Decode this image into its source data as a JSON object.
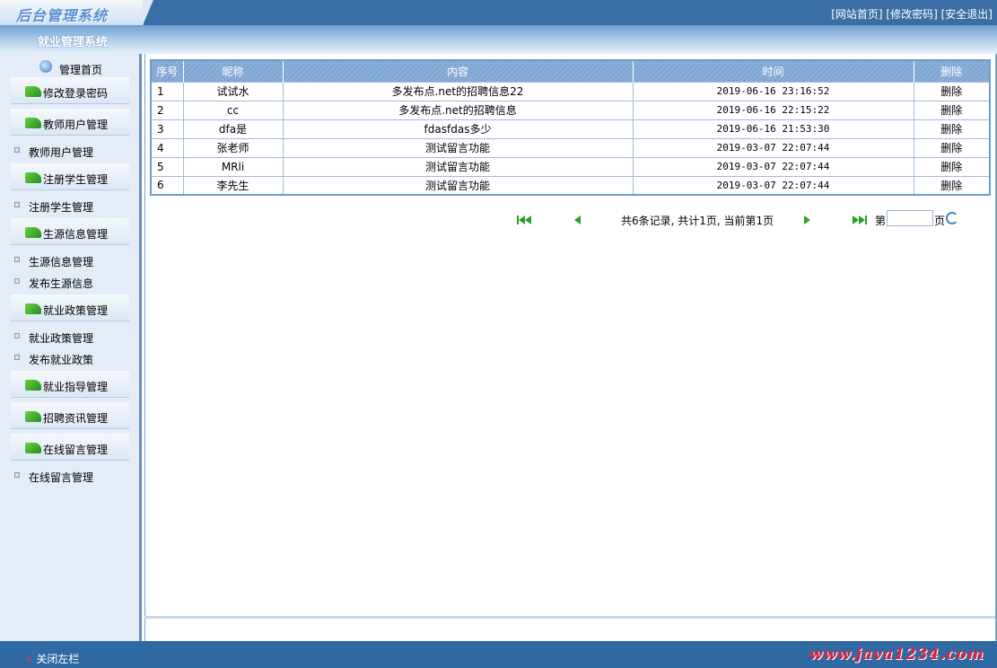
{
  "header": {
    "logo": "后台管理系统",
    "links": [
      "[网站首页]",
      "[修改密码]",
      "[安全退出]"
    ],
    "subtitle": "就业管理系统"
  },
  "sidebar": {
    "home": "管理首页",
    "sections": [
      {
        "label": "修改登录密码",
        "items": []
      },
      {
        "label": "教师用户管理",
        "items": [
          "教师用户管理"
        ]
      },
      {
        "label": "注册学生管理",
        "items": [
          "注册学生管理"
        ]
      },
      {
        "label": "生源信息管理",
        "items": [
          "生源信息管理",
          "发布生源信息"
        ]
      },
      {
        "label": "就业政策管理",
        "items": [
          "就业政策管理",
          "发布就业政策"
        ]
      },
      {
        "label": "就业指导管理",
        "items": []
      },
      {
        "label": "招聘资讯管理",
        "items": []
      },
      {
        "label": "在线留言管理",
        "items": [
          "在线留言管理"
        ]
      }
    ]
  },
  "table": {
    "headers": [
      "序号",
      "昵称",
      "内容",
      "时间",
      "删除"
    ],
    "rows": [
      [
        "1",
        "试试水",
        "多发布点.net的招聘信息22",
        "2019-06-16 23:16:52",
        "删除"
      ],
      [
        "2",
        "cc",
        "多发布点.net的招聘信息",
        "2019-06-16 22:15:22",
        "删除"
      ],
      [
        "3",
        "dfa是",
        "fdasfdas多少",
        "2019-06-16 21:53:30",
        "删除"
      ],
      [
        "4",
        "张老师",
        "测试留言功能",
        "2019-03-07 22:07:44",
        "删除"
      ],
      [
        "5",
        "MRli",
        "测试留言功能",
        "2019-03-07 22:07:44",
        "删除"
      ],
      [
        "6",
        "李先生",
        "测试留言功能",
        "2019-03-07 22:07:44",
        "删除"
      ]
    ]
  },
  "pager": {
    "info": "共6条记录, 共计1页, 当前第1页",
    "label_prefix": "第",
    "label_suffix": "页",
    "page_value": ""
  },
  "footer": {
    "close_left": "关闭左栏",
    "watermark": "www.java1234.com"
  },
  "colors": {
    "header_bg": "#3a6ea5",
    "table_header": "#7ea6d2",
    "sidebar_bg": "#e3ecf7",
    "nav_green": "#2aa12a",
    "watermark": "#e0203a"
  }
}
